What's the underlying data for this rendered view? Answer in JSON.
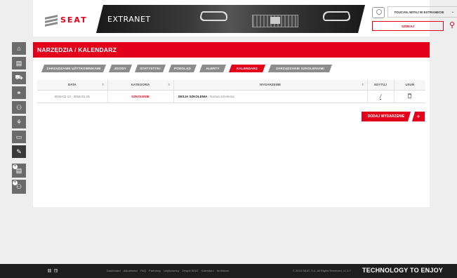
{
  "header": {
    "brand": "SEAT",
    "title": "EXTRANET",
    "user_select": "TOUCAN, WITAJ W EXTRANECIE",
    "search_placeholder": "SZUKAJ"
  },
  "sidebar": {
    "items": [
      {
        "icon": "home-icon"
      },
      {
        "icon": "news-icon"
      },
      {
        "icon": "car-icon"
      },
      {
        "icon": "handshake-icon"
      },
      {
        "icon": "people-icon"
      },
      {
        "icon": "org-chart-icon"
      },
      {
        "icon": "archive-icon"
      },
      {
        "icon": "tools-icon",
        "active": true
      },
      {
        "icon": "add-document-icon"
      },
      {
        "icon": "add-user-icon"
      }
    ]
  },
  "panel": {
    "title": "NARZĘDZIA / KALENDARZ",
    "tabs": [
      {
        "label": "ZARZĄDZANIE UŻYTKOWNIKAMI",
        "active": false
      },
      {
        "label": "ZGODY",
        "active": false
      },
      {
        "label": "STATYSTYKI",
        "active": false
      },
      {
        "label": "PODGLĄD",
        "active": false
      },
      {
        "label": "ALERTY",
        "active": false
      },
      {
        "label": "KALENDARZ",
        "active": true
      },
      {
        "label": "ZARZĄDZANIE SZKOLENIAMI",
        "active": false
      }
    ],
    "table": {
      "columns": [
        "DATA",
        "KATEGORIA",
        "WYDARZENIE",
        "EDYTUJ",
        "USUŃ"
      ],
      "rows": [
        {
          "date": "2016-01-14 - 2016-01-15",
          "category": "SZKOLENIE",
          "event_title": "SESJA SZKOLENIA",
          "event_separator": "/",
          "event_subtitle": "Nazwa Szkolenia"
        }
      ]
    },
    "add_button": "DODAJ WYDARZENIE",
    "add_plus": "+"
  },
  "footer": {
    "social": [
      "f",
      "▶"
    ],
    "links": [
      "Dashboard",
      "Aktualności",
      "FAQ",
      "Partnerzy",
      "Użytkownicy",
      "Zespół SEAT",
      "Kalendarz",
      "Archiwum"
    ],
    "copyright": "© 2015 SEAT, S.A. All Rights Reserved, v1.0.7",
    "slogan": "TECHNOLOGY TO ENJOY"
  },
  "colors": {
    "accent": "#e2001a",
    "tab": "#8c8c8c",
    "sidebar": "#6b6b6b",
    "footer": "#1e1e1e"
  }
}
